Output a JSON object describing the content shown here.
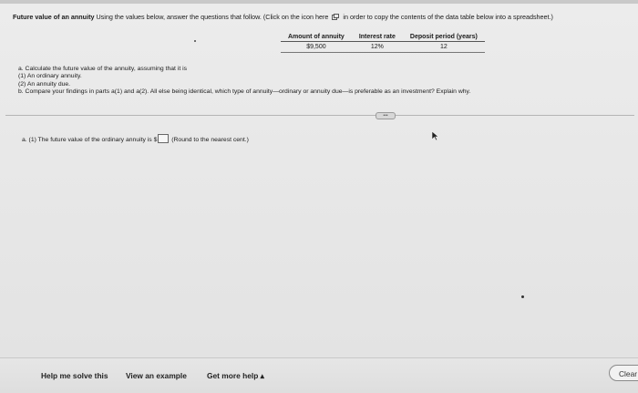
{
  "intro": {
    "title": "Future value of an annuity",
    "text_before_icon": "Using the values below, answer the questions that follow. (Click on the icon here",
    "text_after_icon": "in order to copy the contents of the data table below into a spreadsheet.)"
  },
  "table": {
    "headers": [
      "Amount of annuity",
      "Interest rate",
      "Deposit period (years)"
    ],
    "values": [
      "$9,500",
      "12%",
      "12"
    ]
  },
  "questions": {
    "a": "a. Calculate the future value of the annuity, assuming that it is",
    "a1": "(1) An ordinary annuity.",
    "a2": "(2) An annuity due.",
    "b": "b. Compare your findings in parts a(1) and a(2). All else being identical, which type of annuity—ordinary or annuity due—is preferable as an investment? Explain why."
  },
  "answer": {
    "prefix": "a. (1) The future value of the ordinary annuity is $",
    "suffix": "(Round to the nearest cent.)",
    "value": ""
  },
  "footer": {
    "help_me_solve": "Help me solve this",
    "view_example": "View an example",
    "get_more_help": "Get more help ▴",
    "clear": "Clear"
  },
  "icons": {
    "copy": "copy-icon",
    "cursor": "mouse-pointer-icon",
    "expand": "expand-ellipsis-icon"
  }
}
